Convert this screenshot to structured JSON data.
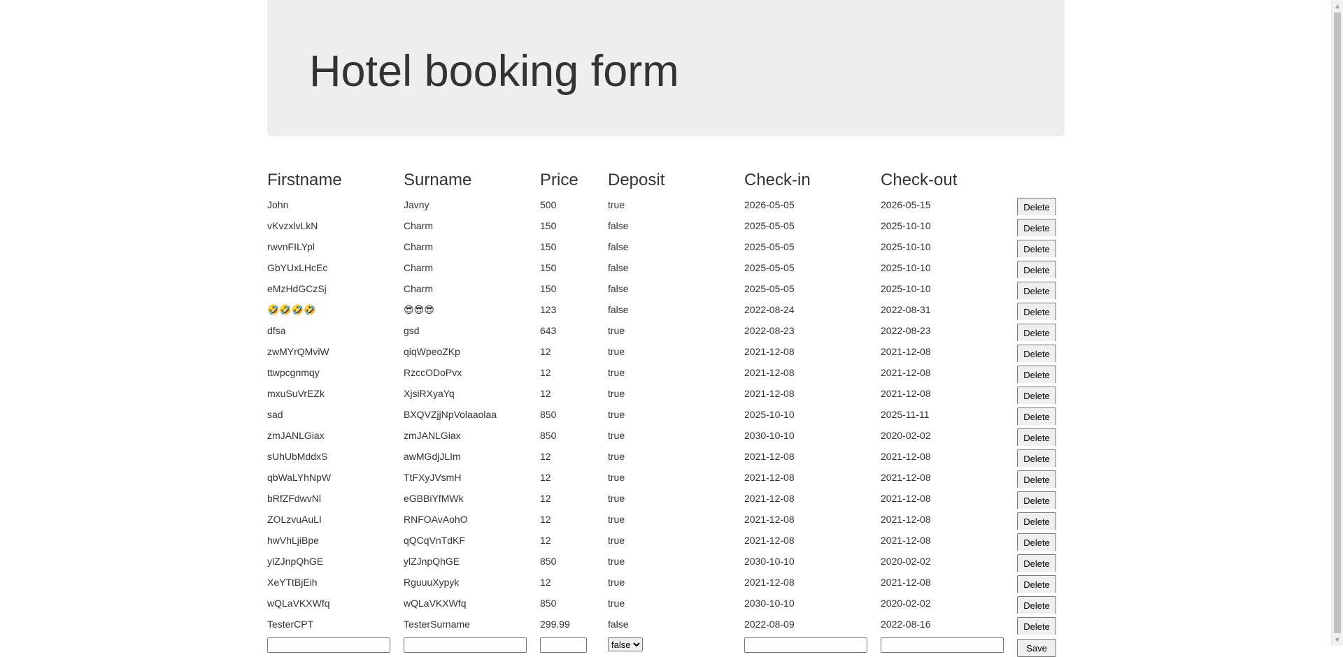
{
  "page": {
    "title": "Hotel booking form"
  },
  "table": {
    "headers": [
      "Firstname",
      "Surname",
      "Price",
      "Deposit",
      "Check-in",
      "Check-out"
    ],
    "delete_label": "Delete",
    "rows": [
      {
        "firstname": "John",
        "surname": "Javny",
        "price": "500",
        "deposit": "true",
        "checkin": "2026-05-05",
        "checkout": "2026-05-15"
      },
      {
        "firstname": "vKvzxlvLkN",
        "surname": "Charm",
        "price": "150",
        "deposit": "false",
        "checkin": "2025-05-05",
        "checkout": "2025-10-10"
      },
      {
        "firstname": "rwvnFILYpl",
        "surname": "Charm",
        "price": "150",
        "deposit": "false",
        "checkin": "2025-05-05",
        "checkout": "2025-10-10"
      },
      {
        "firstname": "GbYUxLHcEc",
        "surname": "Charm",
        "price": "150",
        "deposit": "false",
        "checkin": "2025-05-05",
        "checkout": "2025-10-10"
      },
      {
        "firstname": "eMzHdGCzSj",
        "surname": "Charm",
        "price": "150",
        "deposit": "false",
        "checkin": "2025-05-05",
        "checkout": "2025-10-10"
      },
      {
        "firstname": "🤣🤣🤣🤣",
        "surname": "😎😎😎",
        "price": "123",
        "deposit": "false",
        "checkin": "2022-08-24",
        "checkout": "2022-08-31"
      },
      {
        "firstname": "dfsa",
        "surname": "gsd",
        "price": "643",
        "deposit": "true",
        "checkin": "2022-08-23",
        "checkout": "2022-08-23"
      },
      {
        "firstname": "zwMYrQMviW",
        "surname": "qiqWpeoZKp",
        "price": "12",
        "deposit": "true",
        "checkin": "2021-12-08",
        "checkout": "2021-12-08"
      },
      {
        "firstname": "ttwpcgnmqy",
        "surname": "RzccODoPvx",
        "price": "12",
        "deposit": "true",
        "checkin": "2021-12-08",
        "checkout": "2021-12-08"
      },
      {
        "firstname": "mxuSuVrEZk",
        "surname": "XjsiRXyaYq",
        "price": "12",
        "deposit": "true",
        "checkin": "2021-12-08",
        "checkout": "2021-12-08"
      },
      {
        "firstname": "sad",
        "surname": "BXQVZjjNpVolaaolaa",
        "price": "850",
        "deposit": "true",
        "checkin": "2025-10-10",
        "checkout": "2025-11-11"
      },
      {
        "firstname": "zmJANLGiax",
        "surname": "zmJANLGiax",
        "price": "850",
        "deposit": "true",
        "checkin": "2030-10-10",
        "checkout": "2020-02-02"
      },
      {
        "firstname": "sUhUbMddxS",
        "surname": "awMGdjJLIm",
        "price": "12",
        "deposit": "true",
        "checkin": "2021-12-08",
        "checkout": "2021-12-08"
      },
      {
        "firstname": "qbWaLYhNpW",
        "surname": "TtFXyJVsmH",
        "price": "12",
        "deposit": "true",
        "checkin": "2021-12-08",
        "checkout": "2021-12-08"
      },
      {
        "firstname": "bRfZFdwvNl",
        "surname": "eGBBiYfMWk",
        "price": "12",
        "deposit": "true",
        "checkin": "2021-12-08",
        "checkout": "2021-12-08"
      },
      {
        "firstname": "ZOLzvuAuLI",
        "surname": "RNFOAvAohO",
        "price": "12",
        "deposit": "true",
        "checkin": "2021-12-08",
        "checkout": "2021-12-08"
      },
      {
        "firstname": "hwVhLjiBpe",
        "surname": "qQCqVnTdKF",
        "price": "12",
        "deposit": "true",
        "checkin": "2021-12-08",
        "checkout": "2021-12-08"
      },
      {
        "firstname": "ylZJnpQhGE",
        "surname": "ylZJnpQhGE",
        "price": "850",
        "deposit": "true",
        "checkin": "2030-10-10",
        "checkout": "2020-02-02"
      },
      {
        "firstname": "XeYTtBjEih",
        "surname": "RguuuXypyk",
        "price": "12",
        "deposit": "true",
        "checkin": "2021-12-08",
        "checkout": "2021-12-08"
      },
      {
        "firstname": "wQLaVKXWfq",
        "surname": "wQLaVKXWfq",
        "price": "850",
        "deposit": "true",
        "checkin": "2030-10-10",
        "checkout": "2020-02-02"
      },
      {
        "firstname": "TesterCPT",
        "surname": "TesterSurname",
        "price": "299.99",
        "deposit": "false",
        "checkin": "2022-08-09",
        "checkout": "2022-08-16"
      }
    ]
  },
  "form": {
    "firstname_value": "",
    "surname_value": "",
    "price_value": "",
    "deposit_selected": "false",
    "deposit_options": [
      "true",
      "false"
    ],
    "checkin_value": "",
    "checkout_value": "",
    "save_label": "Save"
  },
  "scrollbar": {
    "up_icon": "scroll-up-arrow",
    "down_icon": "scroll-down-arrow"
  }
}
